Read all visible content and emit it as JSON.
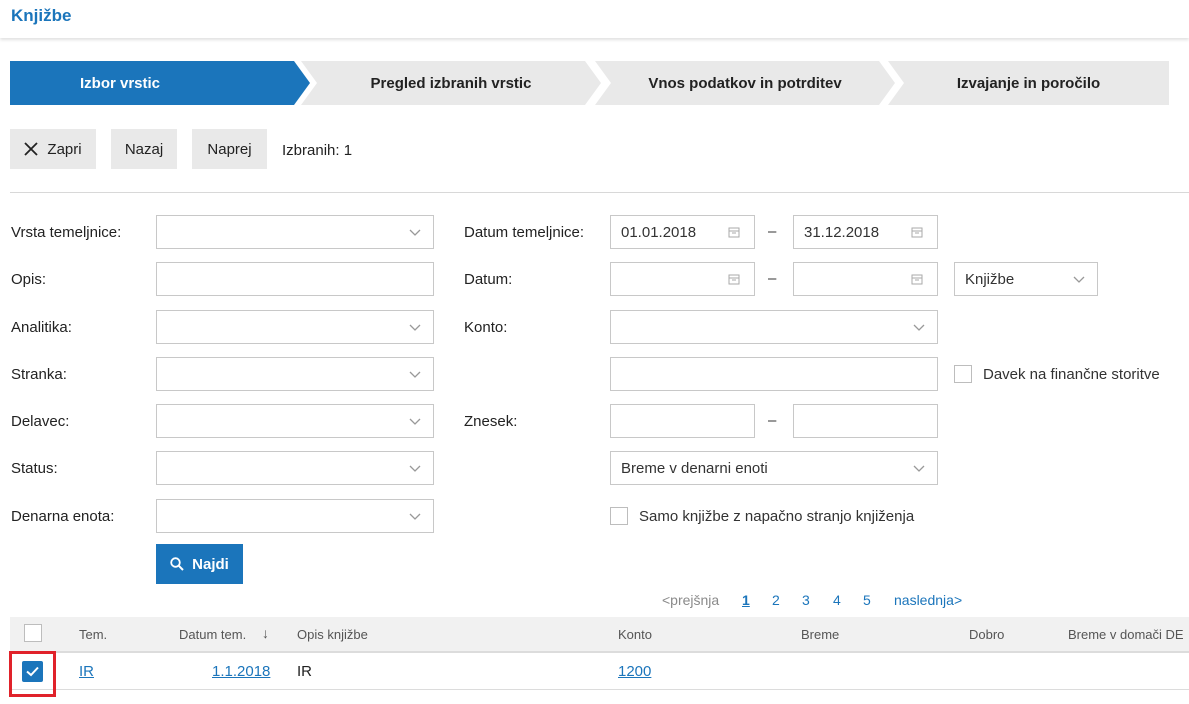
{
  "page": {
    "title": "Knjižbe"
  },
  "wizard": {
    "steps": [
      {
        "label": "Izbor vrstic",
        "active": true
      },
      {
        "label": "Pregled izbranih vrstic",
        "active": false
      },
      {
        "label": "Vnos podatkov in potrditev",
        "active": false
      },
      {
        "label": "Izvajanje in poročilo",
        "active": false
      }
    ]
  },
  "toolbar": {
    "close_label": "Zapri",
    "back_label": "Nazaj",
    "next_label": "Naprej",
    "selected_count": "Izbranih: 1"
  },
  "filters": {
    "vrsta_temeljnice": {
      "label": "Vrsta temeljnice:",
      "value": ""
    },
    "opis": {
      "label": "Opis:",
      "value": ""
    },
    "analitika": {
      "label": "Analitika:",
      "value": ""
    },
    "stranka": {
      "label": "Stranka:",
      "value": ""
    },
    "delavec": {
      "label": "Delavec:",
      "value": ""
    },
    "status": {
      "label": "Status:",
      "value": ""
    },
    "denarna_enota": {
      "label": "Denarna enota:",
      "value": ""
    },
    "datum_temeljnice": {
      "label": "Datum temeljnice:",
      "from": "01.01.2018",
      "to": "31.12.2018"
    },
    "datum": {
      "label": "Datum:",
      "from": "",
      "to": "",
      "type": "Knjižbe"
    },
    "konto": {
      "label": "Konto:",
      "value": "",
      "value2": ""
    },
    "davek": {
      "label": "Davek na finančne storitve",
      "checked": false
    },
    "znesek": {
      "label": "Znesek:",
      "from": "",
      "to": "",
      "type": "Breme v denarni enoti"
    },
    "samo_napacne": {
      "label": "Samo knjižbe z napačno stranjo knjiženja",
      "checked": false
    },
    "dash": "–",
    "search_label": "Najdi"
  },
  "pagination": {
    "prev": "<prejšnja",
    "pages": [
      "1",
      "2",
      "3",
      "4",
      "5"
    ],
    "current": "1",
    "next": "naslednja>"
  },
  "table": {
    "columns": [
      "Tem.",
      "Datum tem.",
      "Opis knjižbe",
      "Konto",
      "Breme",
      "Dobro",
      "Breme v domači DE"
    ],
    "sort_indicator": "↓",
    "rows": [
      {
        "selected": true,
        "tem": "IR",
        "datum": "1.1.2018",
        "opis": "IR",
        "konto": "1200",
        "breme": "",
        "dobro": "",
        "breme_de": ""
      }
    ]
  },
  "colors": {
    "accent": "#1b75bb",
    "step_inactive": "#e9e9e9",
    "highlight": "#e0222a"
  }
}
